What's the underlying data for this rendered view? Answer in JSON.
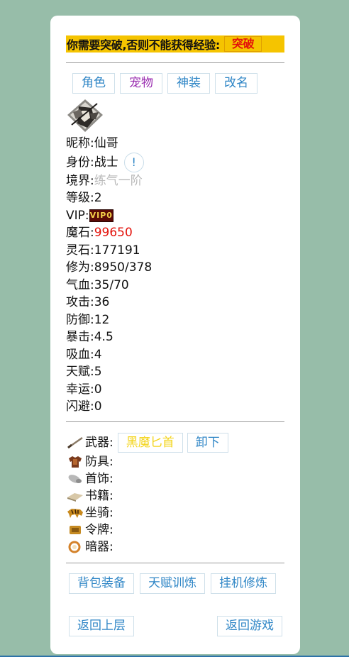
{
  "notice": {
    "text": "你需要突破,否则不能获得经验:",
    "breakthrough_label": "突破"
  },
  "tabs": [
    {
      "label": "角色"
    },
    {
      "label": "宠物"
    },
    {
      "label": "神装"
    },
    {
      "label": "改名"
    }
  ],
  "stats": {
    "nickname": "昵称:仙哥",
    "identity": "身份:战士",
    "info_glyph": "!",
    "realm_label": "境界:",
    "realm_value": "练气一阶",
    "level": "等级:2",
    "vip_label": "VIP:",
    "vip_badge": "VIP0",
    "magic_stone_label": "魔石:",
    "magic_stone_value": "99650",
    "spirit_stone": "灵石:177191",
    "cultivation": "修为:8950/378",
    "hp": "气血:35/70",
    "attack": "攻击:36",
    "defense": "防御:12",
    "crit": "暴击:4.5",
    "lifesteal": "吸血:4",
    "talent": "天赋:5",
    "luck": "幸运:0",
    "dodge": "闪避:0"
  },
  "equipment": {
    "weapon_label": "武器:",
    "weapon_item": "黑魔匕首",
    "unequip_label": "卸下",
    "armor_label": "防具:",
    "accessory_label": "首饰:",
    "book_label": "书籍:",
    "mount_label": "坐骑:",
    "token_label": "令牌:",
    "hidden_weapon_label": "暗器:"
  },
  "actions": {
    "bag_label": "背包装备",
    "talent_training_label": "天赋训炼",
    "idle_cultivation_label": "挂机修炼"
  },
  "nav": {
    "back_label": "返回上层",
    "return_game_label": "返回游戏"
  },
  "colors": {
    "page_bg": "#97bda9",
    "notice_bg": "#f5c400",
    "link_blue": "#2f86c6",
    "pet_purple": "#9a2db0",
    "value_red": "#e3120b",
    "item_yellow": "#f3d41a"
  }
}
